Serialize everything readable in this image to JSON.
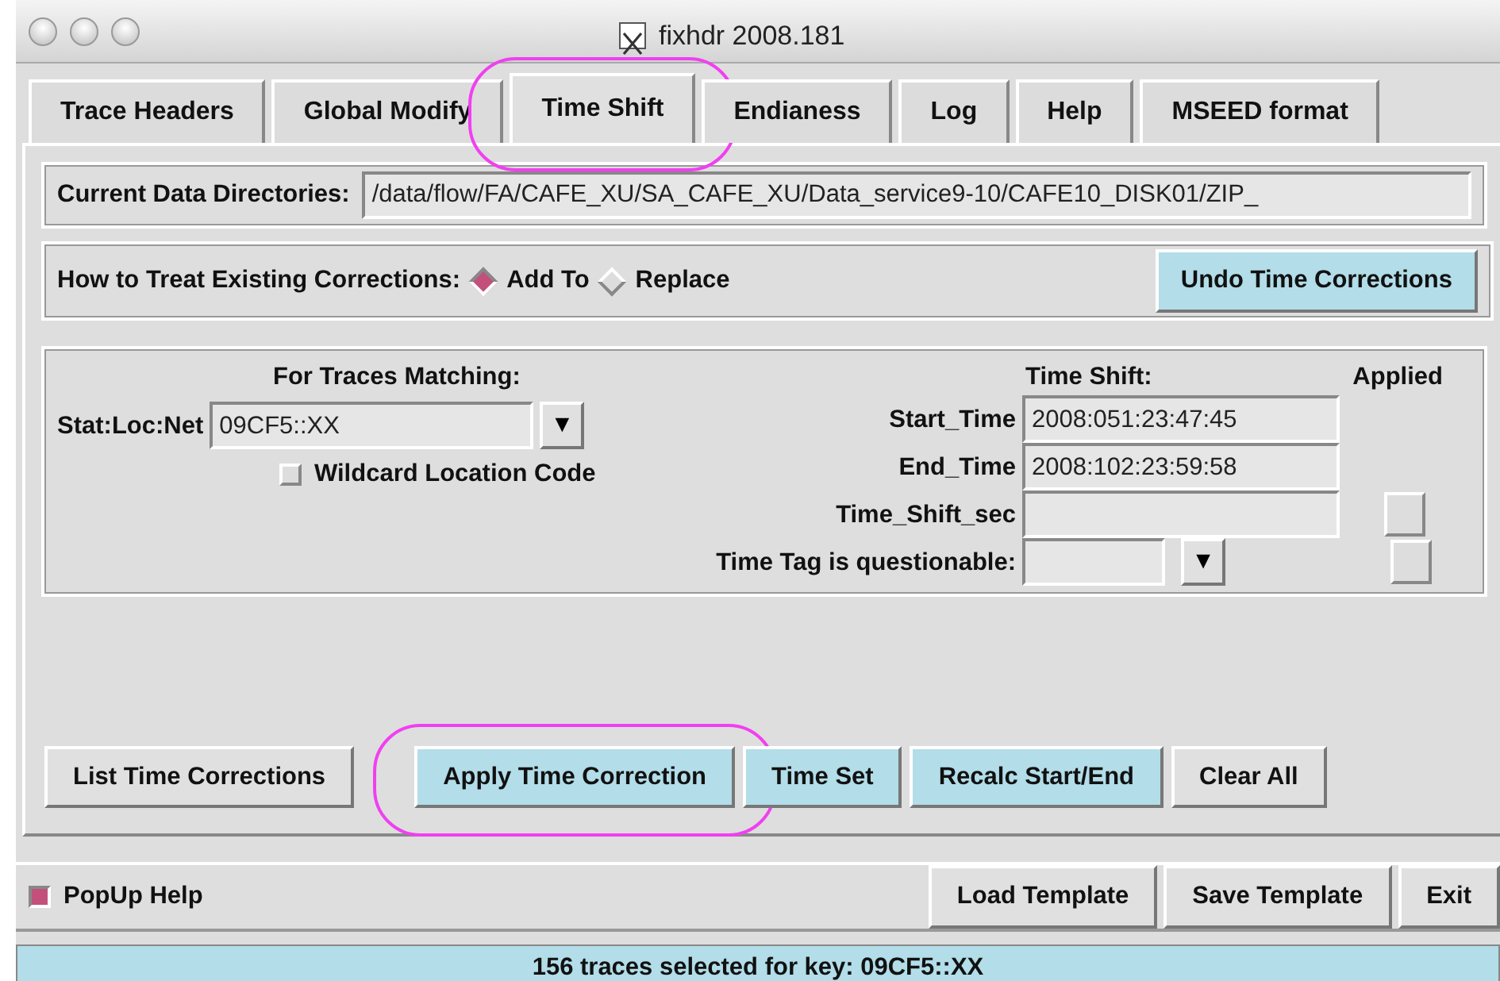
{
  "window": {
    "title": "fixhdr 2008.181"
  },
  "tabs": [
    {
      "label": "Trace Headers",
      "selected": false,
      "circled": false
    },
    {
      "label": "Global Modify",
      "selected": false,
      "circled": false
    },
    {
      "label": "Time Shift",
      "selected": true,
      "circled": true
    },
    {
      "label": "Endianess",
      "selected": false,
      "circled": false
    },
    {
      "label": "Log",
      "selected": false,
      "circled": false
    },
    {
      "label": "Help",
      "selected": false,
      "circled": false
    },
    {
      "label": "MSEED format",
      "selected": false,
      "circled": false
    }
  ],
  "directories": {
    "label": "Current Data Directories:",
    "value": "/data/flow/FA/CAFE_XU/SA_CAFE_XU/Data_service9-10/CAFE10_DISK01/ZIP_"
  },
  "corrections": {
    "label": "How to Treat Existing Corrections:",
    "options": [
      {
        "label": "Add To",
        "selected": true
      },
      {
        "label": "Replace",
        "selected": false
      }
    ],
    "button": {
      "label": "Undo Time Corrections",
      "highlighted": true
    }
  },
  "matching": {
    "heading": "For Traces Matching:",
    "label": "Stat:Loc:Net",
    "value": "09CF5::XX",
    "dropdown": "▼",
    "wildcard": {
      "label": "Wildcard Location Code",
      "checked": false
    }
  },
  "shift": {
    "heading": "Time Shift:",
    "applied_heading": "Applied",
    "rows": [
      {
        "kind": "text",
        "label": "Start_Time",
        "value": "2008:051:23:47:45"
      },
      {
        "kind": "text",
        "label": "End_Time",
        "value": "2008:102:23:59:58"
      },
      {
        "kind": "text_applicable",
        "label": "Time_Shift_sec"
      },
      {
        "kind": "dropdown_applicable",
        "label": "Time Tag is questionable:",
        "dropdown": "▼"
      }
    ]
  },
  "actions": [
    {
      "label": "List Time Corrections",
      "highlighted": false,
      "circled": false
    },
    {
      "label": "Apply Time Correction",
      "highlighted": true,
      "circled": true
    },
    {
      "label": "Time Set",
      "highlighted": true,
      "circled": false
    },
    {
      "label": "Recalc Start/End",
      "highlighted": true,
      "circled": false
    },
    {
      "label": "Clear All",
      "highlighted": false,
      "circled": false
    }
  ],
  "popup_help": {
    "label": "PopUp Help",
    "checked": true
  },
  "footer_buttons": [
    "Load Template",
    "Save Template",
    "Exit"
  ],
  "status_bar": "156 traces selected for key: 09CF5::XX"
}
